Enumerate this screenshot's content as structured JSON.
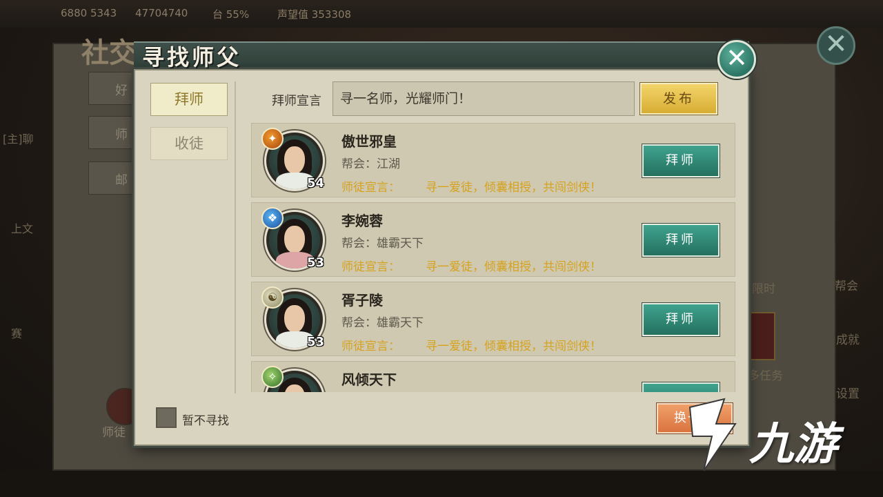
{
  "background": {
    "stats": [
      "6880 5343",
      "47704740",
      "台 55%",
      "声望值 353308"
    ],
    "social_title": "社交",
    "tabs": [
      "好",
      "师",
      "邮"
    ],
    "side_texts": [
      "[主]聊",
      "上文",
      "赛"
    ],
    "right_texts": [
      "限时",
      "帮会",
      "成就",
      "多任务",
      "设置"
    ],
    "avatar_label": "师徒"
  },
  "dialog": {
    "title": "寻找师父",
    "close_symbol": "✕",
    "tabs": {
      "active": "拜师",
      "inactive": "收徒"
    },
    "announce": {
      "label": "拜师宣言",
      "value": "寻一名师，光耀师门！",
      "publish": "发布"
    },
    "rows": [
      {
        "name": "傲世邪皇",
        "guild": "帮会：江湖",
        "declare_label": "师徒宣言：",
        "declare": "寻一爱徒，倾囊相授，共闯剑侠！",
        "level": "54",
        "button": "拜师",
        "badge": "fire-class-icon"
      },
      {
        "name": "李婉蓉",
        "guild": "帮会：雄霸天下",
        "declare_label": "师徒宣言：",
        "declare": "寻一爱徒，倾囊相授，共闯剑侠！",
        "level": "53",
        "button": "拜师",
        "badge": "water-class-icon"
      },
      {
        "name": "胥子陵",
        "guild": "帮会：雄霸天下",
        "declare_label": "师徒宣言：",
        "declare": "寻一爱徒，倾囊相授，共闯剑侠！",
        "level": "53",
        "button": "拜师",
        "badge": "wind-class-icon"
      },
      {
        "name": "风倾天下",
        "guild": "",
        "declare_label": "",
        "declare": "",
        "level": "",
        "button": "",
        "badge": "leaf-class-icon"
      }
    ],
    "checkbox_label": "暂不寻找",
    "refresh": "换一批"
  },
  "watermark": {
    "text": "九游"
  },
  "colors": {
    "header": "#304039",
    "panel": "#d9d4bf",
    "row": "#cfc9b2",
    "green_button": "#24705f",
    "gold_button": "#d7ad33",
    "orange_button": "#d9733e",
    "declare_text": "#d6a21e"
  }
}
